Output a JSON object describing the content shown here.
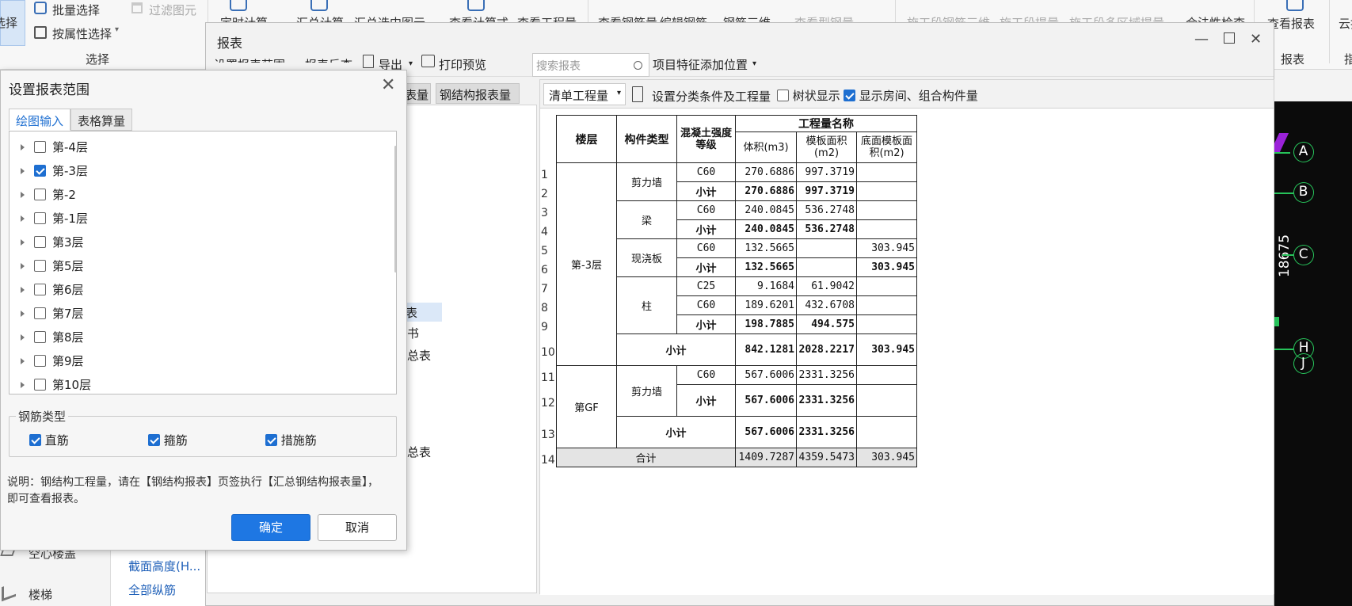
{
  "ribbon": {
    "buttons": [
      "选择",
      "批量选择",
      "过滤图元",
      "按属性选择",
      "定时计算",
      "汇总计算",
      "汇总选中图元",
      "查看计算式",
      "查看工程量",
      "查看钢筋量",
      "编辑钢筋",
      "钢筋三维",
      "查看型钢量",
      "施工段钢筋三维",
      "施工段提量",
      "施工段多区域提量",
      "合法性检查",
      "查看报表",
      "云指标"
    ],
    "groups": [
      "选择",
      "报表",
      "指"
    ]
  },
  "left_panel": {
    "items": [
      "空心楼盖",
      "楼梯"
    ]
  },
  "mid_panel": {
    "items": [
      "截面高度(H...",
      "全部纵筋"
    ]
  },
  "report_window": {
    "title": "报表",
    "toolbar": {
      "set_range": "设置报表范围",
      "report_reverse": "报表反查",
      "export": "导出",
      "print_preview": "打印预览",
      "search_placeholder": "搜索报表",
      "feature_position": "项目特征添加位置"
    },
    "tabs": [
      "表量",
      "钢结构报表量"
    ],
    "tree_fragments": [
      "表",
      "书",
      "总表",
      "总表"
    ],
    "right_toolbar": {
      "category": "清单工程量",
      "set_condition": "设置分类条件及工程量",
      "tree_display": "树状显示",
      "show_room": "显示房间、组合构件量"
    },
    "table": {
      "headers": {
        "floor": "楼层",
        "component": "构件类型",
        "concrete": "混凝土强度等级",
        "quantity_name": "工程量名称",
        "volume": "体积(m3)",
        "formwork": "模板面积(m2)",
        "bottom_formwork": "底面模板面积(m2)"
      },
      "row_numbers": [
        "1",
        "2",
        "3",
        "4",
        "5",
        "6",
        "7",
        "8",
        "9",
        "10",
        "11",
        "12",
        "13",
        "14"
      ],
      "rows": [
        {
          "grade": "C60",
          "volume": "270.6886",
          "formwork": "997.3719",
          "bottom": ""
        },
        {
          "grade": "小计",
          "volume": "270.6886",
          "formwork": "997.3719",
          "bottom": ""
        },
        {
          "grade": "C60",
          "volume": "240.0845",
          "formwork": "536.2748",
          "bottom": ""
        },
        {
          "grade": "小计",
          "volume": "240.0845",
          "formwork": "536.2748",
          "bottom": ""
        },
        {
          "grade": "C60",
          "volume": "132.5665",
          "formwork": "",
          "bottom": "303.945"
        },
        {
          "grade": "小计",
          "volume": "132.5665",
          "formwork": "",
          "bottom": "303.945"
        },
        {
          "grade": "C25",
          "volume": "9.1684",
          "formwork": "61.9042",
          "bottom": ""
        },
        {
          "grade": "C60",
          "volume": "189.6201",
          "formwork": "432.6708",
          "bottom": ""
        },
        {
          "grade": "小计",
          "volume": "198.7885",
          "formwork": "494.575",
          "bottom": ""
        },
        {
          "grade": "小计",
          "volume": "842.1281",
          "formwork": "2028.2217",
          "bottom": "303.945"
        },
        {
          "grade": "C60",
          "volume": "567.6006",
          "formwork": "2331.3256",
          "bottom": ""
        },
        {
          "grade": "小计",
          "volume": "567.6006",
          "formwork": "2331.3256",
          "bottom": ""
        },
        {
          "grade": "小计",
          "volume": "567.6006",
          "formwork": "2331.3256",
          "bottom": ""
        },
        {
          "grade": "合计",
          "volume": "1409.7287",
          "formwork": "4359.5473",
          "bottom": "303.945"
        }
      ],
      "floor_labels": [
        "第-3层",
        "第GF"
      ],
      "component_labels": [
        "剪力墙",
        "梁",
        "现浇板",
        "柱",
        "剪力墙"
      ],
      "subtotal": "小计",
      "total": "合计"
    }
  },
  "canvas": {
    "axes": [
      "A",
      "B",
      "C",
      "H",
      "J"
    ],
    "dimension": "18675"
  },
  "dialog": {
    "title": "设置报表范围",
    "tabs": [
      "绘图输入",
      "表格算量"
    ],
    "floors": [
      {
        "label": "第-4层",
        "checked": false
      },
      {
        "label": "第-3层",
        "checked": true
      },
      {
        "label": "第-2",
        "checked": false
      },
      {
        "label": "第-1层",
        "checked": false
      },
      {
        "label": "第3层",
        "checked": false
      },
      {
        "label": "第5层",
        "checked": false
      },
      {
        "label": "第6层",
        "checked": false
      },
      {
        "label": "第7层",
        "checked": false
      },
      {
        "label": "第8层",
        "checked": false
      },
      {
        "label": "第9层",
        "checked": false
      },
      {
        "label": "第10层",
        "checked": false
      }
    ],
    "rebar_type_label": "钢筋类型",
    "rebar_types": [
      {
        "label": "直筋",
        "checked": true
      },
      {
        "label": "箍筋",
        "checked": true
      },
      {
        "label": "措施筋",
        "checked": true
      }
    ],
    "note": "说明：钢结构工程量，请在【钢结构报表】页签执行【汇总钢结构报表量】，即可查看报表。",
    "ok": "确定",
    "cancel": "取消"
  },
  "colors": {
    "accent": "#1e77e3",
    "canvas_bg": "#0b0b0b",
    "axis_ring": "#27c25a"
  }
}
